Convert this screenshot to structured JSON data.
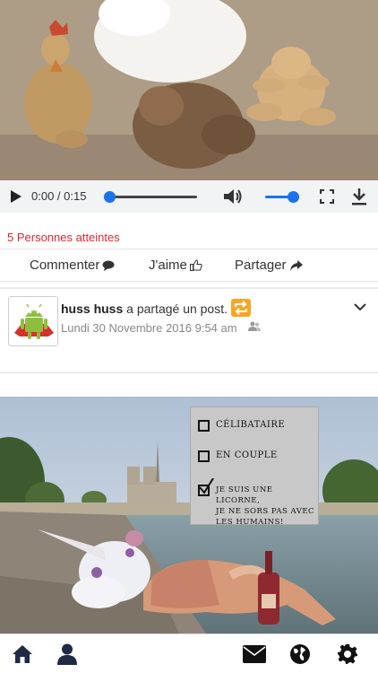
{
  "video": {
    "time": "0:00 / 0:15",
    "progress": 0.0,
    "volume": 1.0
  },
  "reach_text": "5 Personnes atteintes",
  "actions": {
    "comment_label": "Commenter",
    "like_label": "J'aime",
    "share_label": "Partager"
  },
  "post": {
    "author": "huss huss",
    "action_text": "a partagé un post.",
    "date": "Lundi 30 Novembre 2016 9:54 am",
    "image_sign": {
      "option1": "CÉLIBATAIRE",
      "option2": "EN COUPLE",
      "option3_line1": "JE SUIS UNE LICORNE,",
      "option3_line2": "JE NE SORS PAS AVEC",
      "option3_line3": "LES HUMAINS!"
    }
  },
  "colors": {
    "accent": "#1a73e8",
    "reach": "#e0272b",
    "share_badge": "#f6a623"
  },
  "nav": [
    "home-icon",
    "user-icon",
    "envelope-icon",
    "globe-icon",
    "gear-icon"
  ]
}
